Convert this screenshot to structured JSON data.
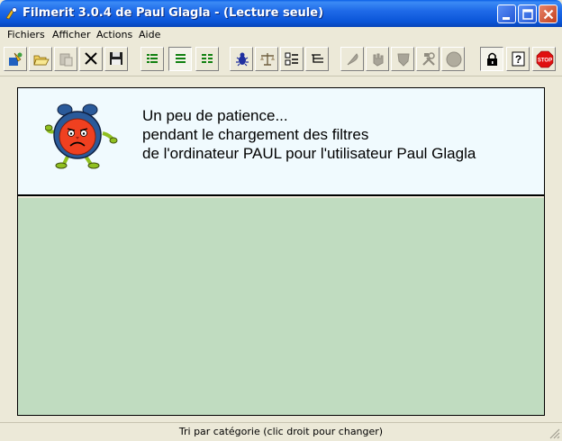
{
  "window": {
    "title": "Filmerit 3.0.4 de Paul Glagla - (Lecture seule)"
  },
  "menu": [
    {
      "label": "Fichiers"
    },
    {
      "label": "Afficher"
    },
    {
      "label": "Actions"
    },
    {
      "label": "Aide"
    }
  ],
  "toolbar": {
    "buttons": [
      {
        "icon": "connect-icon",
        "enabled": true
      },
      {
        "icon": "open-folder-icon",
        "enabled": true
      },
      {
        "icon": "paste-icon",
        "enabled": false
      },
      {
        "icon": "cut-icon",
        "enabled": true
      },
      {
        "icon": "save-icon",
        "enabled": true
      },
      {
        "icon": "list-view-icon",
        "enabled": true
      },
      {
        "icon": "list-view-alt-icon",
        "enabled": true,
        "pressed": true
      },
      {
        "icon": "list-view-detail-icon",
        "enabled": true
      },
      {
        "icon": "bug-icon",
        "enabled": true
      },
      {
        "icon": "scale-icon",
        "enabled": true
      },
      {
        "icon": "properties-icon",
        "enabled": true
      },
      {
        "icon": "tree-icon",
        "enabled": true
      },
      {
        "icon": "feather-icon",
        "enabled": false
      },
      {
        "icon": "hand-icon",
        "enabled": false
      },
      {
        "icon": "shield-icon",
        "enabled": false
      },
      {
        "icon": "tools-icon",
        "enabled": false
      },
      {
        "icon": "ball-icon",
        "enabled": false
      },
      {
        "icon": "lock-icon",
        "enabled": true,
        "pressed": true
      },
      {
        "icon": "help-icon",
        "enabled": true
      },
      {
        "icon": "stop-icon",
        "enabled": true,
        "label": "STOP"
      }
    ]
  },
  "loading": {
    "line1": "Un peu de patience...",
    "line2": "pendant le chargement des filtres",
    "line3": "de l'ordinateur PAUL pour l'utilisateur Paul Glagla"
  },
  "status": {
    "text": "Tri par catégorie (clic droit pour changer)"
  },
  "colors": {
    "titlebar": "#0a55d8",
    "loading_bg": "#f0fafe",
    "content_bg": "#c0dcc0",
    "chrome": "#ece9d8"
  }
}
